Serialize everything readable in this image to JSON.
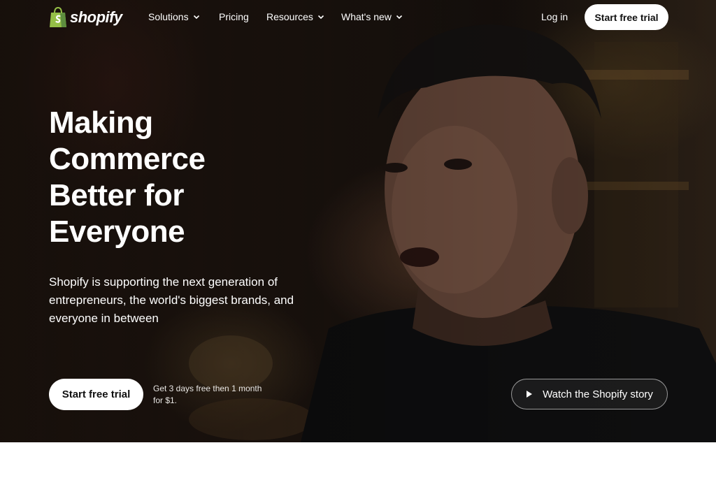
{
  "brand": {
    "name": "shopify",
    "logo_icon": "shopping-bag-icon",
    "logo_color": "#95bf47"
  },
  "nav": {
    "items": [
      {
        "label": "Solutions",
        "has_dropdown": true
      },
      {
        "label": "Pricing",
        "has_dropdown": false
      },
      {
        "label": "Resources",
        "has_dropdown": true
      },
      {
        "label": "What's new",
        "has_dropdown": true
      }
    ],
    "login_label": "Log in",
    "cta_label": "Start free trial"
  },
  "hero": {
    "headline_lines": [
      "Making",
      "Commerce",
      "Better for",
      "Everyone"
    ],
    "subhead": "Shopify is supporting the next generation of entrepreneurs, the world's biggest brands, and everyone in between",
    "cta_label": "Start free trial",
    "trial_note": "Get 3 days free then 1 month for $1.",
    "watch_label": "Watch the Shopify story",
    "watch_icon": "play-icon"
  },
  "colors": {
    "hero_text": "#ffffff",
    "button_bg": "#ffffff",
    "button_text": "#111111"
  }
}
